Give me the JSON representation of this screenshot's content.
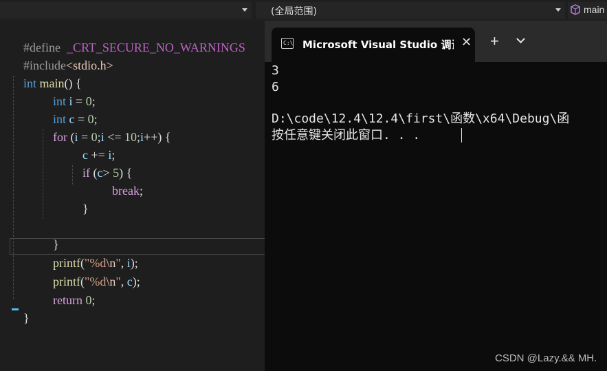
{
  "navbar": {
    "scope_label": "(全局范围)",
    "member_label": "main"
  },
  "editor": {
    "lines": [
      {
        "pp": "#define",
        "macro": "_CRT_SECURE_NO_WARNINGS"
      },
      {
        "pp": "#include",
        "inc": "<stdio.h>"
      },
      {
        "kw": "int",
        "fn": "main",
        "rest": "() {"
      },
      {
        "kw": "int",
        "var": "i",
        "op": " = ",
        "num": "0",
        "end": ";"
      },
      {
        "kw": "int",
        "var": "c",
        "op": " = ",
        "num": "0",
        "end": ";"
      },
      {
        "kw": "for",
        "a": " (",
        "v1": "i",
        "b": " = ",
        "n1": "0",
        "c": ";",
        "v2": "i",
        "d": " <= ",
        "n2": "10",
        "e": ";",
        "v3": "i",
        "f": "++) {"
      },
      {
        "var": "c",
        "op": " += ",
        "var2": "i",
        "end": ";"
      },
      {
        "kw": "if",
        "a": " (",
        "var": "c",
        "b": "> ",
        "num": "5",
        "c": ") {"
      },
      {
        "kw": "break",
        "end": ";"
      },
      {
        "text": "}"
      },
      {
        "text": "}"
      },
      {
        "fn": "printf",
        "a": "(",
        "s1": "\"%d",
        "esc": "\\n",
        "s2": "\"",
        "b": ", ",
        "var": "i",
        "c": ");"
      },
      {
        "fn": "printf",
        "a": "(",
        "s1": "\"%d",
        "esc": "\\n",
        "s2": "\"",
        "b": ", ",
        "var": "c",
        "c": ");"
      },
      {
        "kw": "return",
        "op": " ",
        "num": "0",
        "end": ";"
      },
      {
        "text": "}"
      }
    ]
  },
  "console": {
    "tab_icon_text": "C:\\",
    "tab_title": "Microsoft Visual Studio 调试控制台",
    "tab_close": "✕",
    "tab_add": "+",
    "output": [
      "3",
      "6",
      "",
      "D:\\code\\12.4\\12.4\\first\\函数\\x64\\Debug\\函",
      "按任意键关闭此窗口. . ."
    ]
  },
  "watermark": "CSDN @Lazy.&& MH."
}
